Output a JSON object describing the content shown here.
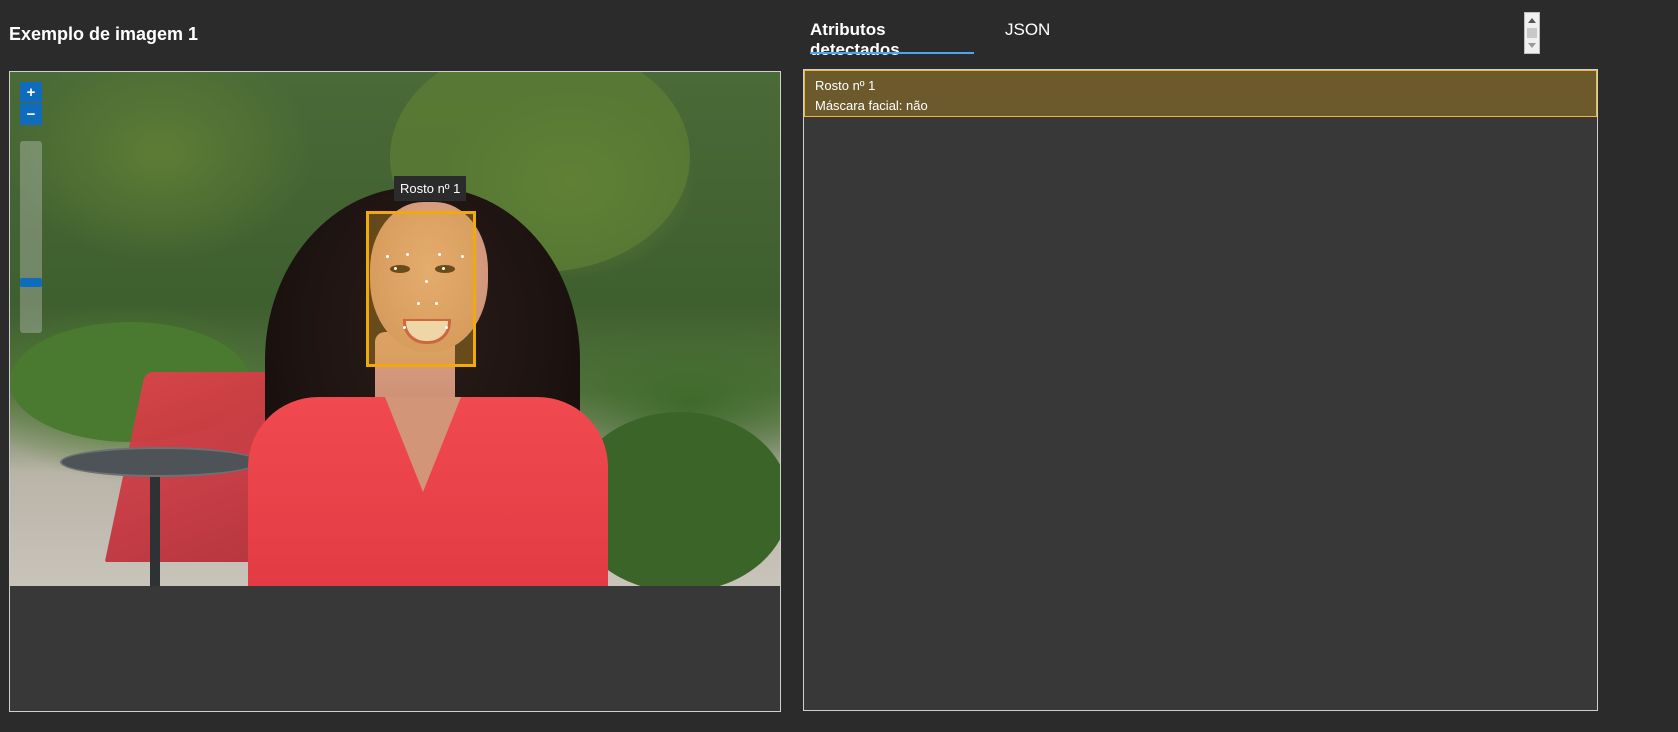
{
  "left_panel": {
    "title": "Exemplo de imagem 1",
    "zoom": {
      "zoom_in_label": "+",
      "zoom_out_label": "−",
      "level": 0.12
    },
    "face_label": "Rosto nº 1",
    "highlight_color": "#f0a90e"
  },
  "right_panel": {
    "tabs": [
      {
        "label": "Atributos detectados",
        "active": true
      },
      {
        "label": "JSON",
        "active": false
      }
    ],
    "results": [
      {
        "title": "Rosto nº 1",
        "attribute": "Máscara facial: não"
      }
    ],
    "accent_color": "#4ea4ee"
  }
}
